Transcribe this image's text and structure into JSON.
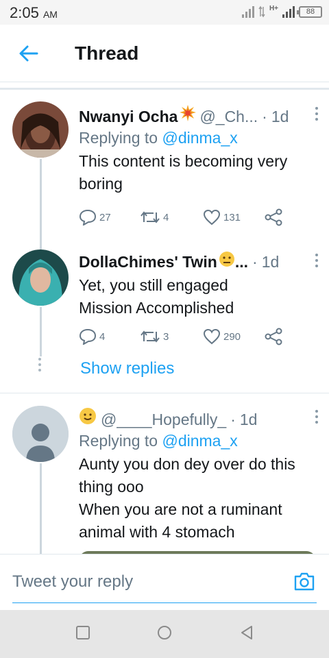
{
  "status_bar": {
    "time": "2:05",
    "ampm": "AM",
    "network": "H+",
    "battery": "88"
  },
  "header": {
    "title": "Thread"
  },
  "tweets": [
    {
      "name": "Nwanyi Ocha",
      "handle": "@_Ch...",
      "dot": "·",
      "time": "1d",
      "reply_prefix": "Replying to",
      "reply_to": "@dinma_x",
      "text": "This content is becoming very\nboring",
      "replies": "27",
      "retweets": "4",
      "likes": "131"
    },
    {
      "name": "DollaChimes' Twin",
      "name_suffix": "...",
      "dot": "·",
      "time": "1d",
      "text": "Yet, you still engaged\nMission Accomplished",
      "replies": "4",
      "retweets": "3",
      "likes": "290"
    },
    {
      "handle": "@____Hopefully_",
      "dot": "·",
      "time": "1d",
      "reply_prefix": "Replying to",
      "reply_to": "@dinma_x",
      "text": "Aunty you don dey over do this\nthing ooo\nWhen you are not a ruminant\nanimal with 4 stomach"
    }
  ],
  "show_replies": "Show replies",
  "reply_bar": {
    "placeholder": "Tweet your reply"
  },
  "colors": {
    "accent": "#1da1f2",
    "muted": "#657786",
    "text": "#14171a"
  },
  "icons": [
    "back-arrow-icon",
    "comment-icon",
    "retweet-icon",
    "heart-icon",
    "share-icon",
    "camera-icon",
    "more-icon",
    "nav-square-icon",
    "nav-circle-icon",
    "nav-back-icon"
  ]
}
